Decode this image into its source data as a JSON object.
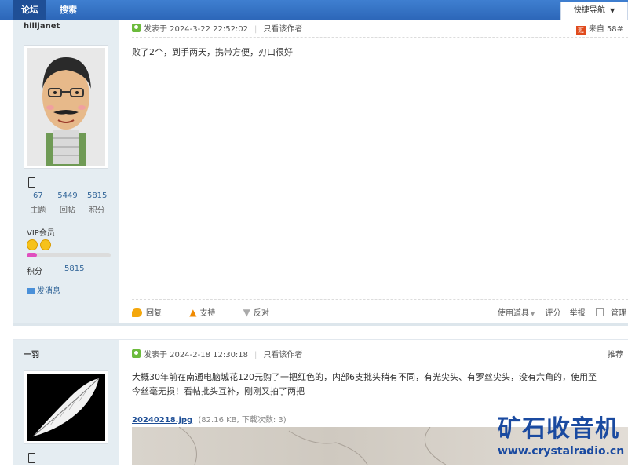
{
  "topnav": {
    "forum": "论坛",
    "search": "搜索",
    "quick_nav": "快捷导航"
  },
  "post1": {
    "username": "hilljanet",
    "stats": [
      {
        "value": "67",
        "label": "主题"
      },
      {
        "value": "5449",
        "label": "回帖"
      },
      {
        "value": "5815",
        "label": "积分"
      }
    ],
    "group": "VIP会员",
    "progress_fraction": 0.12,
    "points_label": "积分",
    "points_value": "5815",
    "send_message": "发消息",
    "posted_at": "发表于 2024-3-22 22:52:02",
    "only_author": "只看该作者",
    "from_label": "来自",
    "floor": "58#",
    "content": "败了2个，到手两天，携带方便，刃口很好",
    "actions": {
      "reply": "回复",
      "support": "支持",
      "oppose": "反对",
      "tools": "使用道具",
      "rate": "评分",
      "report": "举报",
      "manage": "管理"
    }
  },
  "post2": {
    "username": "一羽",
    "posted_at": "发表于 2024-2-18 12:30:18",
    "only_author": "只看该作者",
    "recommend": "推荐",
    "content_line1": "大概30年前在南通电脑城花120元购了一把红色的，内部6支批头稍有不同，有光尖头、有罗丝尖头，没有六角的，使用至",
    "content_line2": "今丝毫无损！看帖批头互补，刚刚又拍了两把",
    "attachment_name": "20240218.jpg",
    "attachment_info": "(82.16 KB, 下载次数: 3)"
  },
  "watermark": {
    "title": "矿石收音机",
    "url": "www.crystalradio.cn"
  }
}
